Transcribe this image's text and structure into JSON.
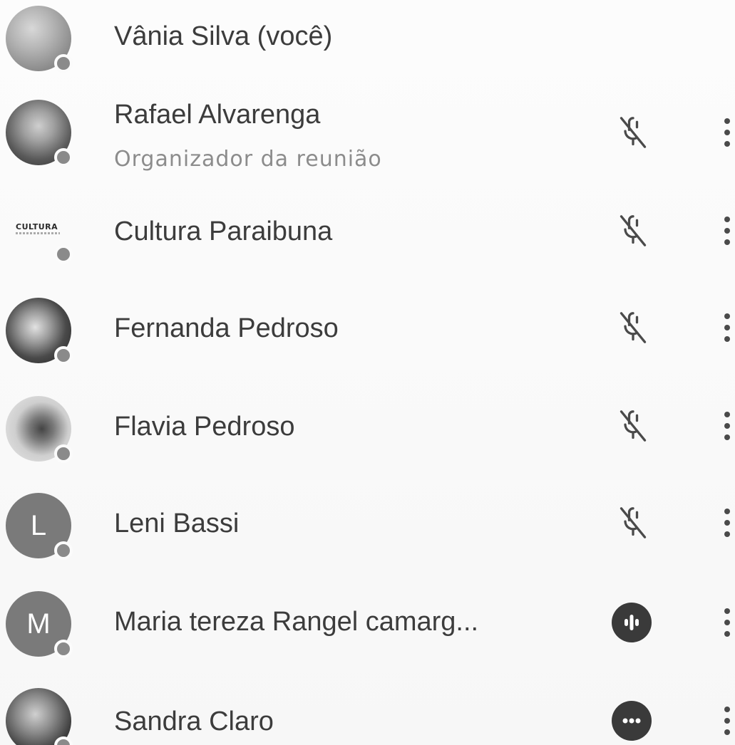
{
  "participants": [
    {
      "name": "Vânia Silva (você)",
      "subtitle": "",
      "avatar": "photo",
      "status": "muted",
      "show_actions": false
    },
    {
      "name": "Rafael Alvarenga",
      "subtitle": "Organizador da reunião",
      "avatar": "photo",
      "status": "muted",
      "show_actions": true
    },
    {
      "name": "Cultura Paraibuna",
      "subtitle": "",
      "avatar": "logo",
      "logo_text": "CULTURA",
      "status": "muted",
      "show_actions": true
    },
    {
      "name": "Fernanda Pedroso",
      "subtitle": "",
      "avatar": "photo",
      "status": "muted",
      "show_actions": true
    },
    {
      "name": "Flavia Pedroso",
      "subtitle": "",
      "avatar": "photo",
      "status": "muted",
      "show_actions": true
    },
    {
      "name": "Leni Bassi",
      "subtitle": "",
      "avatar": "letter",
      "avatar_letter": "L",
      "status": "muted",
      "show_actions": true
    },
    {
      "name": "Maria tereza Rangel camarg...",
      "subtitle": "",
      "avatar": "letter",
      "avatar_letter": "M",
      "status": "speaking",
      "show_actions": true
    },
    {
      "name": "Sandra Claro",
      "subtitle": "",
      "avatar": "photo",
      "status": "more",
      "show_actions": true
    }
  ],
  "icons": {
    "mic_off": "mic-off-icon",
    "speaking": "audio-level-icon",
    "more_status": "more-horiz-icon",
    "more_vert": "more-vert-icon"
  },
  "colors": {
    "text": "#3c3c3c",
    "subtitle": "#8c8c8c",
    "status_dot": "#8a8a8a",
    "icon": "#4a4a4a"
  }
}
